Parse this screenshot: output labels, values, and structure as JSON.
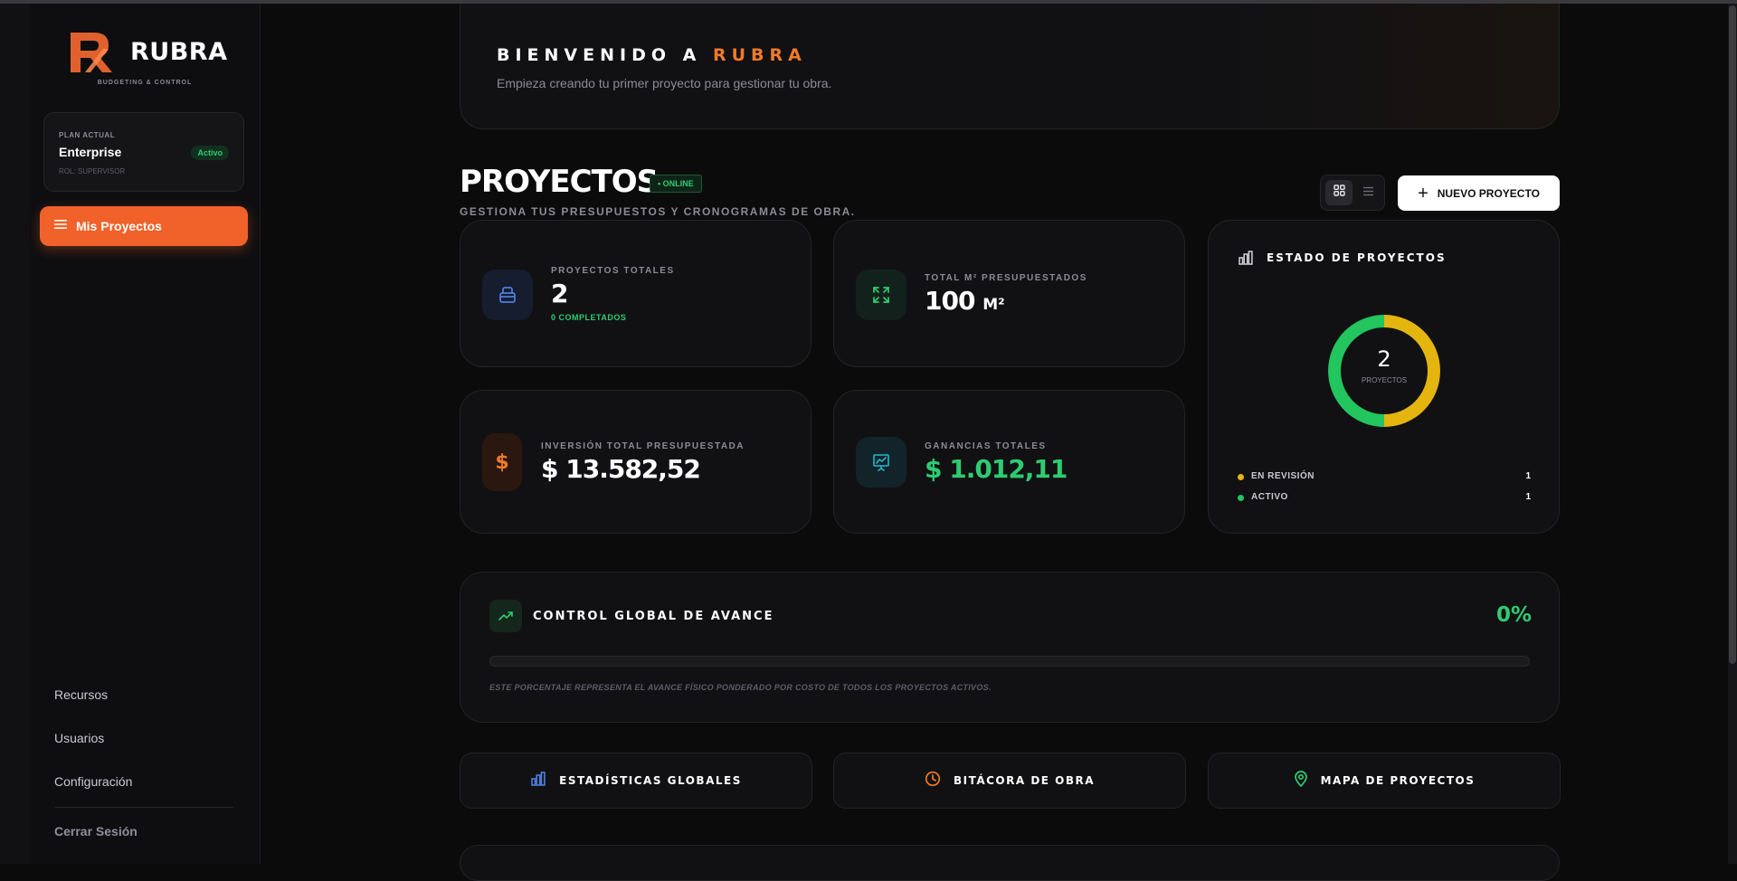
{
  "sidebar": {
    "brand": "RUBRA",
    "tagline": "BUDGETING & CONTROL",
    "plan": {
      "label": "PLAN ACTUAL",
      "name": "Enterprise",
      "status": "Activo",
      "role": "ROL: SUPERVISOR"
    },
    "active_item": "Mis Proyectos",
    "links": [
      "Recursos",
      "Usuarios",
      "Configuración"
    ],
    "logout": "Cerrar Sesión"
  },
  "welcome": {
    "title_prefix": "BIENVENIDO A",
    "title_brand": "RUBRA",
    "subtitle": "Empieza creando tu primer proyecto para gestionar tu obra."
  },
  "projects": {
    "title": "PROYECTOS",
    "badge": "• ONLINE",
    "subtitle": "GESTIONA TUS PRESUPUESTOS Y CRONOGRAMAS DE OBRA.",
    "new_button": "NUEVO PROYECTO"
  },
  "stats": {
    "total_projects": {
      "label": "PROYECTOS TOTALES",
      "value": "2",
      "note": "0 COMPLETADOS"
    },
    "total_m2": {
      "label": "TOTAL M² PRESUPUESTADOS",
      "value": "100",
      "unit": "M²"
    },
    "investment": {
      "label": "INVERSIÓN TOTAL PRESUPUESTADA",
      "value": "$ 13.582,52"
    },
    "earnings": {
      "label": "GANANCIAS TOTALES",
      "value": "$ 1.012,11"
    }
  },
  "estado": {
    "title": "ESTADO DE PROYECTOS",
    "center_value": "2",
    "center_label": "PROYECTOS",
    "legend": [
      {
        "label": "EN REVISIÓN",
        "count": "1",
        "color": "#e5b50f"
      },
      {
        "label": "ACTIVO",
        "count": "1",
        "color": "#22c55e"
      }
    ]
  },
  "chart_data": {
    "type": "pie",
    "title": "ESTADO DE PROYECTOS",
    "categories": [
      "EN REVISIÓN",
      "ACTIVO"
    ],
    "values": [
      1,
      1
    ],
    "colors": [
      "#e5b50f",
      "#22c55e"
    ]
  },
  "control": {
    "title": "CONTROL GLOBAL DE AVANCE",
    "percent_label": "0%",
    "progress": 0,
    "note": "ESTE PORCENTAJE REPRESENTA EL AVANCE FÍSICO PONDERADO POR COSTO DE TODOS LOS PROYECTOS ACTIVOS."
  },
  "quick_links": {
    "stats": "ESTADÍSTICAS GLOBALES",
    "log": "BITÁCORA DE OBRA",
    "map": "MAPA DE PROYECTOS"
  },
  "colors": {
    "accent": "#f0622a",
    "success": "#2ecc71",
    "warning": "#e5b50f",
    "background": "#0b0b0c",
    "card": "#111113"
  },
  "icons": {
    "brand_logo": "rubra-r-logo",
    "menu": "hamburger-icon",
    "grid_view": "grid-icon",
    "list_view": "list-icon",
    "total_projects": "box-icon",
    "total_m2": "expand-icon",
    "investment": "dollar-icon",
    "earnings": "presentation-chart-icon",
    "estado": "bar-chart-icon",
    "control": "trending-up-icon",
    "stats_link": "bar-chart-icon",
    "log_link": "clock-icon",
    "map_link": "map-pin-icon"
  }
}
